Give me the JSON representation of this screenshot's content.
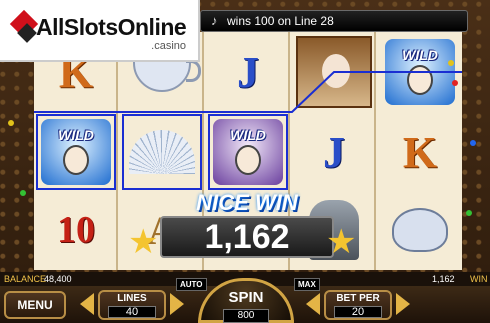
{
  "logo": {
    "name": "AllSlotsOnline",
    "sub": ".casino"
  },
  "message": {
    "note_icon": "♪",
    "text": "wins 100 on Line 28"
  },
  "reels": [
    [
      "K",
      "WILD",
      "10"
    ],
    [
      "teacup",
      "fan",
      "A"
    ],
    [
      "J",
      "WILD",
      "A"
    ],
    [
      "queen",
      "J",
      "knight"
    ],
    [
      "WILD",
      "K",
      "teapot"
    ]
  ],
  "win": {
    "label": "NICE WIN",
    "amount": "1,162"
  },
  "info": {
    "balance_label": "BALANCE",
    "balance_value": "48,400",
    "win_value": "1,162",
    "win_label": "WIN"
  },
  "controls": {
    "menu_label": "MENU",
    "lines_label": "LINES",
    "lines_value": "40",
    "auto_label": "AUTO",
    "spin_label": "SPIN",
    "spin_value": "800",
    "max_label": "MAX",
    "betper_label": "BET PER",
    "betper_value": "20"
  },
  "colors": {
    "payline": "#1a2ed2",
    "accent_gold": "#d1a444"
  }
}
